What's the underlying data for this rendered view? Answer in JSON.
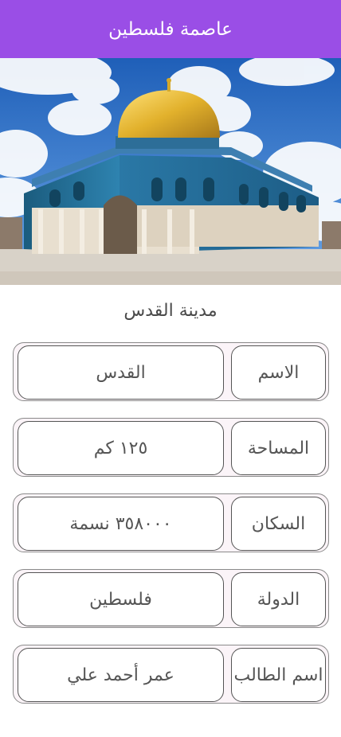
{
  "app_bar": {
    "title": "عاصمة فلسطين"
  },
  "hero": {
    "image_alt": "Dome of the Rock"
  },
  "section": {
    "title": "مدينة القدس"
  },
  "rows": [
    {
      "label": "الاسم",
      "value": "القدس"
    },
    {
      "label": "المساحة",
      "value": "١٢٥ كم"
    },
    {
      "label": "السكان",
      "value": "٣٥٨٠٠٠ نسمة"
    },
    {
      "label": "الدولة",
      "value": "فلسطين"
    },
    {
      "label": "اسم الطالب",
      "value": "عمر أحمد علي"
    }
  ],
  "colors": {
    "app_bar": "#9a4ee6",
    "row_bg": "#fbf4f8",
    "text": "#555555"
  }
}
